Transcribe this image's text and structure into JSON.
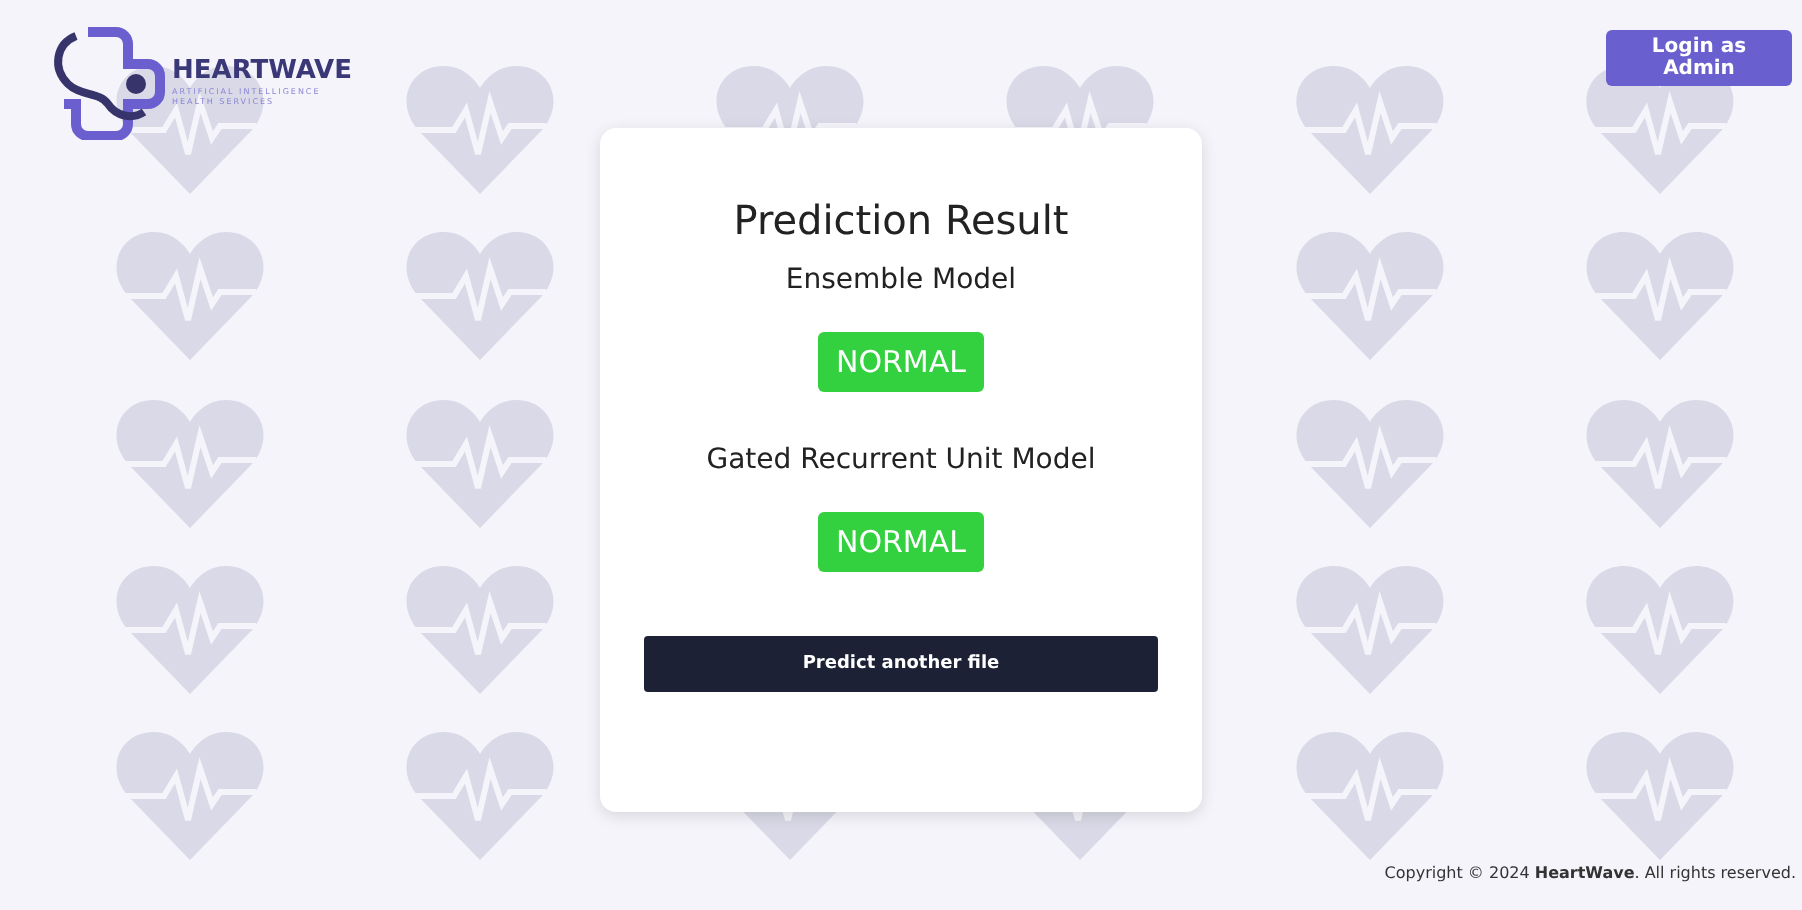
{
  "logo": {
    "name": "HEARTWAVE",
    "tagline": [
      "ARTIFICIAL INTELLIGENCE",
      "HEALTH SERVICES"
    ]
  },
  "admin_button": "Login as Admin",
  "card": {
    "title": "Prediction Result",
    "results": [
      {
        "model": "Ensemble Model",
        "result": "NORMAL"
      },
      {
        "model": "Gated Recurrent Unit Model",
        "result": "NORMAL"
      }
    ],
    "button": "Predict another file"
  },
  "footer": "Copyright © 2024 **HeartWave**. All rights reserved."
}
